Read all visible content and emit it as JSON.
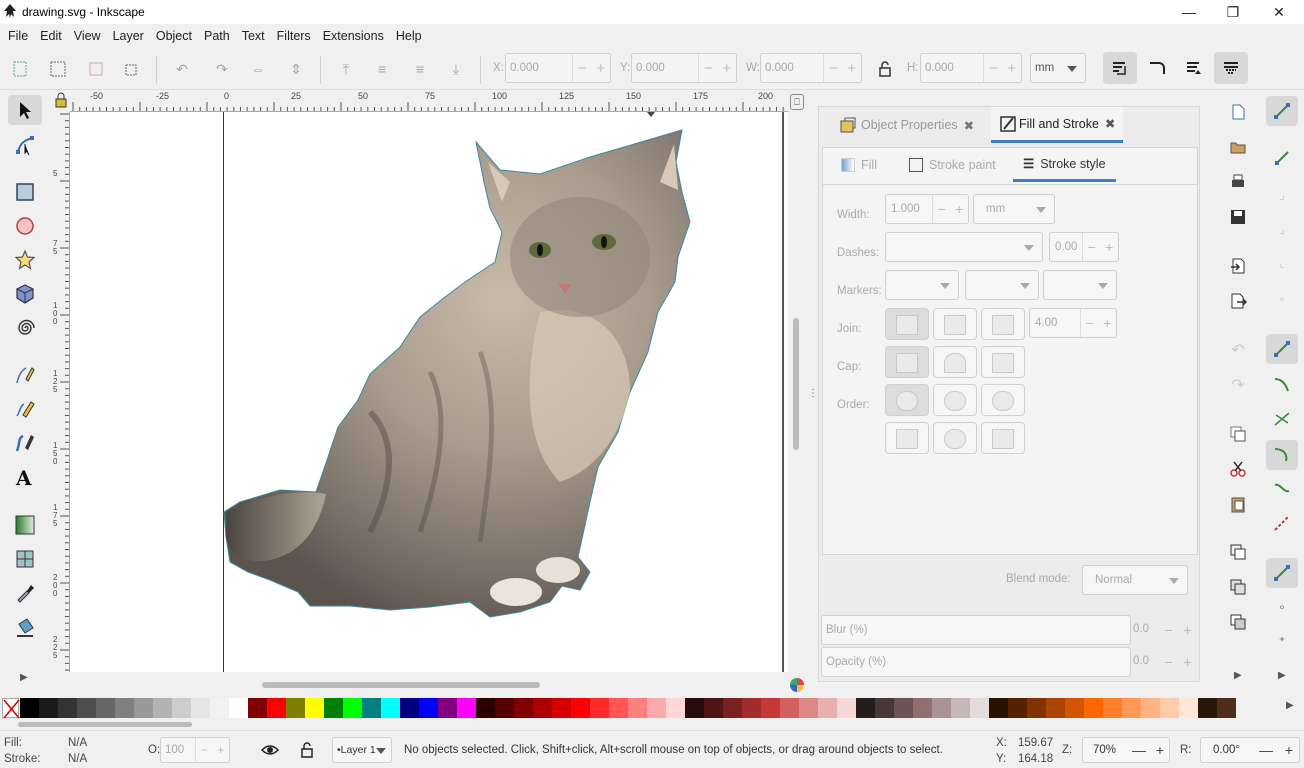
{
  "window": {
    "title": "drawing.svg - Inkscape",
    "minimize": "—",
    "maximize": "❐",
    "close": "✕"
  },
  "menu": [
    "File",
    "Edit",
    "View",
    "Layer",
    "Object",
    "Path",
    "Text",
    "Filters",
    "Extensions",
    "Help"
  ],
  "toolbar": {
    "x_label": "X:",
    "x_value": "0.000",
    "y_label": "Y:",
    "y_value": "0.000",
    "w_label": "W:",
    "w_value": "0.000",
    "h_label": "H:",
    "h_value": "0.000",
    "unit": "mm",
    "minus": "−",
    "plus": "+"
  },
  "ruler_top": [
    "-50",
    "-25",
    "0",
    "25",
    "50",
    "75",
    "100",
    "125",
    "150",
    "175",
    "200"
  ],
  "ruler_left": [
    "5",
    "7\n5",
    "1\n0\n0",
    "1\n2\n5",
    "1\n5\n0",
    "1\n7\n5",
    "2\n0\n0",
    "2\n2\n5"
  ],
  "dock": {
    "tab1": "Object Properties",
    "tab2": "Fill and Stroke",
    "subtab_fill": "Fill",
    "subtab_stroke_paint": "Stroke paint",
    "subtab_stroke_style": "Stroke style",
    "width_label": "Width:",
    "width_value": "1.000",
    "width_unit": "mm",
    "dashes_label": "Dashes:",
    "dashes_value": "0.00",
    "markers_label": "Markers:",
    "join_label": "Join:",
    "miter_value": "4.00",
    "cap_label": "Cap:",
    "order_label": "Order:",
    "blend_label": "Blend mode:",
    "blend_value": "Normal",
    "blur_label": "Blur (%)",
    "blur_value": "0.0",
    "opacity_label": "Opacity (%)",
    "opacity_value": "0.0",
    "minus": "−",
    "plus": "+"
  },
  "palette_colors": [
    "#000000",
    "#1a1a1a",
    "#333333",
    "#4d4d4d",
    "#666666",
    "#808080",
    "#999999",
    "#b3b3b3",
    "#cccccc",
    "#e6e6e6",
    "#f2f2f2",
    "#ffffff",
    "#800000",
    "#ff0000",
    "#808000",
    "#ffff00",
    "#008000",
    "#00ff00",
    "#008080",
    "#00ffff",
    "#000080",
    "#0000ff",
    "#800080",
    "#ff00ff",
    "#2b0000",
    "#550000",
    "#800000",
    "#aa0000",
    "#d40000",
    "#ff0000",
    "#ff2a2a",
    "#ff5555",
    "#ff8080",
    "#ffaaaa",
    "#ffd5d5",
    "#280b0b",
    "#501616",
    "#782121",
    "#a02c2c",
    "#c83737",
    "#d35f5f",
    "#de8787",
    "#e9afaf",
    "#f4d7d7",
    "#241c1c",
    "#483737",
    "#6c5353",
    "#916f6f",
    "#ac9393",
    "#c8b7b7",
    "#e3dbdb",
    "#2b1100",
    "#552200",
    "#803300",
    "#aa4400",
    "#d45500",
    "#ff6600",
    "#ff7f2a",
    "#ff9955",
    "#ffb380",
    "#ffccaa",
    "#ffe6d5",
    "#28170b",
    "#502d16"
  ],
  "status": {
    "fill_label": "Fill:",
    "fill_value": "N/A",
    "stroke_label": "Stroke:",
    "stroke_value": "N/A",
    "opacity_label": "O:",
    "opacity_value": "100",
    "layer": "•Layer 1",
    "message": "No objects selected. Click, Shift+click, Alt+scroll mouse on top of objects, or drag around objects to select.",
    "x_label": "X:",
    "x_value": "159.67",
    "y_label": "Y:",
    "y_value": "164.18",
    "zoom_label": "Z:",
    "zoom_value": "70%",
    "rot_label": "R:",
    "rot_value": "0.00°",
    "minus": "—",
    "plus": "+"
  }
}
